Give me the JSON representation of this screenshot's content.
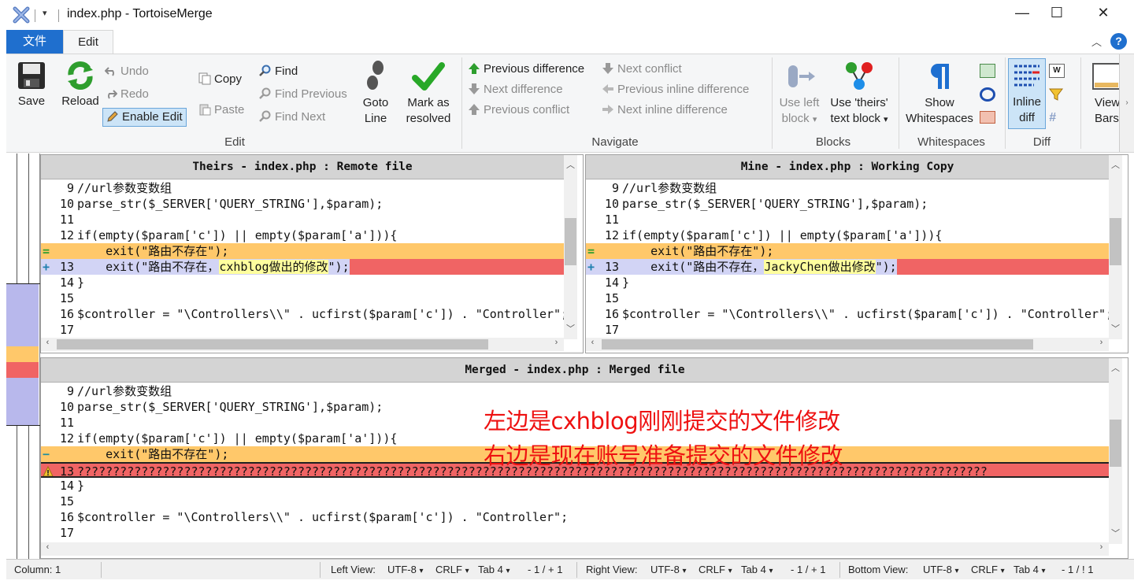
{
  "window": {
    "title": "index.php - TortoiseMerge",
    "qa_arrow": "▾",
    "minimize": "—",
    "maximize": "☐",
    "close": "✕"
  },
  "menu": {
    "file_label": "文件",
    "edit_label": "Edit",
    "collapse_ribbon": "︿",
    "help": "?"
  },
  "ribbon": {
    "edit": {
      "save": "Save",
      "reload": "Reload",
      "undo": "Undo",
      "redo": "Redo",
      "enable_edit": "Enable Edit",
      "copy": "Copy",
      "paste": "Paste",
      "find": "Find",
      "find_previous": "Find Previous",
      "find_next": "Find Next",
      "goto_line_1": "Goto",
      "goto_line_2": "Line",
      "mark_resolved_1": "Mark as",
      "mark_resolved_2": "resolved",
      "group_label": "Edit"
    },
    "navigate": {
      "previous_difference": "Previous difference",
      "next_difference": "Next difference",
      "previous_conflict": "Previous conflict",
      "next_conflict": "Next conflict",
      "previous_inline_difference": "Previous inline difference",
      "next_inline_difference": "Next inline difference",
      "group_label": "Navigate"
    },
    "blocks": {
      "use_left_1": "Use left",
      "use_left_2": "block",
      "use_theirs_1": "Use 'theirs'",
      "use_theirs_2": "text block",
      "dropdown": "▾",
      "group_label": "Blocks"
    },
    "whitespaces": {
      "show_1": "Show",
      "show_2": "Whitespaces",
      "group_label": "Whitespaces"
    },
    "diff": {
      "inline_1": "Inline",
      "inline_2": "diff",
      "group_label": "Diff"
    },
    "view": {
      "bars_1": "View",
      "bars_2": "Bars"
    }
  },
  "panes": {
    "theirs": {
      "header": "Theirs - index.php : Remote file",
      "lines": [
        {
          "marker": "",
          "num": "9",
          "text": "//url参数变数组",
          "style": "normal"
        },
        {
          "marker": "",
          "num": "10",
          "text": "parse_str($_SERVER['QUERY_STRING'],$param);",
          "style": "normal"
        },
        {
          "marker": "",
          "num": "11",
          "text": "",
          "style": "normal"
        },
        {
          "marker": "",
          "num": "12",
          "text": "if(empty($param['c']) || empty($param['a'])){",
          "style": "normal"
        },
        {
          "marker": "=",
          "num": "",
          "text": "    exit(\"路由不存在\");",
          "style": "removed"
        },
        {
          "marker": "+",
          "num": "13",
          "text_before": "    exit(\"路由不存在，",
          "text_hl": "cxhblog做出的修改",
          "text_after": "\");",
          "style": "added"
        },
        {
          "marker": "",
          "num": "14",
          "text": "}",
          "style": "normal"
        },
        {
          "marker": "",
          "num": "15",
          "text": "",
          "style": "normal"
        },
        {
          "marker": "",
          "num": "16",
          "text": "$controller = \"\\Controllers\\\\\" . ucfirst($param['c']) . \"Controller\";",
          "style": "normal"
        },
        {
          "marker": "",
          "num": "17",
          "text": "",
          "style": "normal"
        }
      ]
    },
    "mine": {
      "header": "Mine - index.php : Working Copy",
      "lines": [
        {
          "marker": "",
          "num": "9",
          "text": "//url参数变数组",
          "style": "normal"
        },
        {
          "marker": "",
          "num": "10",
          "text": "parse_str($_SERVER['QUERY_STRING'],$param);",
          "style": "normal"
        },
        {
          "marker": "",
          "num": "11",
          "text": "",
          "style": "normal"
        },
        {
          "marker": "",
          "num": "12",
          "text": "if(empty($param['c']) || empty($param['a'])){",
          "style": "normal"
        },
        {
          "marker": "=",
          "num": "",
          "text": "    exit(\"路由不存在\");",
          "style": "removed"
        },
        {
          "marker": "+",
          "num": "13",
          "text_before": "    exit(\"路由不存在，",
          "text_hl": "JackyChen做出修改",
          "text_after": "\");",
          "style": "added"
        },
        {
          "marker": "",
          "num": "14",
          "text": "}",
          "style": "normal"
        },
        {
          "marker": "",
          "num": "15",
          "text": "",
          "style": "normal"
        },
        {
          "marker": "",
          "num": "16",
          "text": "$controller = \"\\Controllers\\\\\" . ucfirst($param['c']) . \"Controller\";",
          "style": "normal"
        },
        {
          "marker": "",
          "num": "17",
          "text": "",
          "style": "normal"
        }
      ]
    },
    "merged": {
      "header": "Merged - index.php : Merged file",
      "lines": [
        {
          "marker": "",
          "num": "9",
          "text": "//url参数变数组",
          "style": "normal"
        },
        {
          "marker": "",
          "num": "10",
          "text": "parse_str($_SERVER['QUERY_STRING'],$param);",
          "style": "normal"
        },
        {
          "marker": "",
          "num": "11",
          "text": "",
          "style": "normal"
        },
        {
          "marker": "",
          "num": "12",
          "text": "if(empty($param['c']) || empty($param['a'])){",
          "style": "normal"
        },
        {
          "marker": "−",
          "num": "",
          "text": "    exit(\"路由不存在\");",
          "style": "removed"
        },
        {
          "marker": "!",
          "num": "13",
          "text": "????????????????????????????????????????????????????????????????????????????????????????????????????????????????????????????????",
          "style": "conflict"
        },
        {
          "marker": "",
          "num": "14",
          "text": "}",
          "style": "normal"
        },
        {
          "marker": "",
          "num": "15",
          "text": "",
          "style": "normal"
        },
        {
          "marker": "",
          "num": "16",
          "text": "$controller = \"\\Controllers\\\\\" . ucfirst($param['c']) . \"Controller\";",
          "style": "normal"
        },
        {
          "marker": "",
          "num": "17",
          "text": "",
          "style": "normal"
        }
      ]
    }
  },
  "annotations": {
    "line1": "左边是cxhblog刚刚提交的文件修改",
    "line2": "右边是现在账号准备提交的文件修改"
  },
  "statusbar": {
    "column": "Column: 1",
    "left_view_label": "Left View:",
    "right_view_label": "Right View:",
    "bottom_view_label": "Bottom View:",
    "encoding": "UTF-8",
    "eol": "CRLF",
    "tab": "Tab 4",
    "left_counts": "- 1 / + 1",
    "right_counts": "- 1 / + 1",
    "bottom_counts": "- 1 / ! 1",
    "dropdown": "▾"
  },
  "colors": {
    "removed_bg": "#ffc86a",
    "added_bg": "#d2d4f5",
    "added_fill": "#f06464",
    "inline_hl": "#ffff9e",
    "conflict_bg": "#f06464",
    "accent": "#1f6fce",
    "annotation": "#ee1111"
  }
}
